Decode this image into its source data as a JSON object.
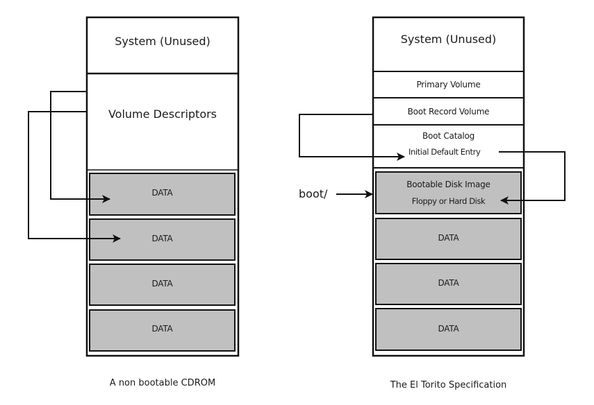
{
  "left_diagram": {
    "caption": "A non bootable CDROM",
    "sections": {
      "system": "System (Unused)",
      "volume_descriptors": "Volume Descriptors"
    },
    "data_blocks": [
      "DATA",
      "DATA",
      "DATA",
      "DATA"
    ]
  },
  "right_diagram": {
    "caption": "The El Torito Specification",
    "sections": {
      "system": "System (Unused)",
      "primary_volume": "Primary Volume",
      "boot_record_volume": "Boot Record Volume",
      "boot_catalog_line1": "Boot Catalog",
      "boot_catalog_line2": "Initial Default Entry"
    },
    "bootable_image_line1": "Bootable Disk Image",
    "bootable_image_line2": "Floppy or Hard Disk",
    "data_blocks": [
      "DATA",
      "DATA",
      "DATA"
    ],
    "pointer_label": "boot/"
  },
  "colors": {
    "stroke": "#111111",
    "data_fill": "#c0c0c0",
    "background": "#ffffff"
  }
}
